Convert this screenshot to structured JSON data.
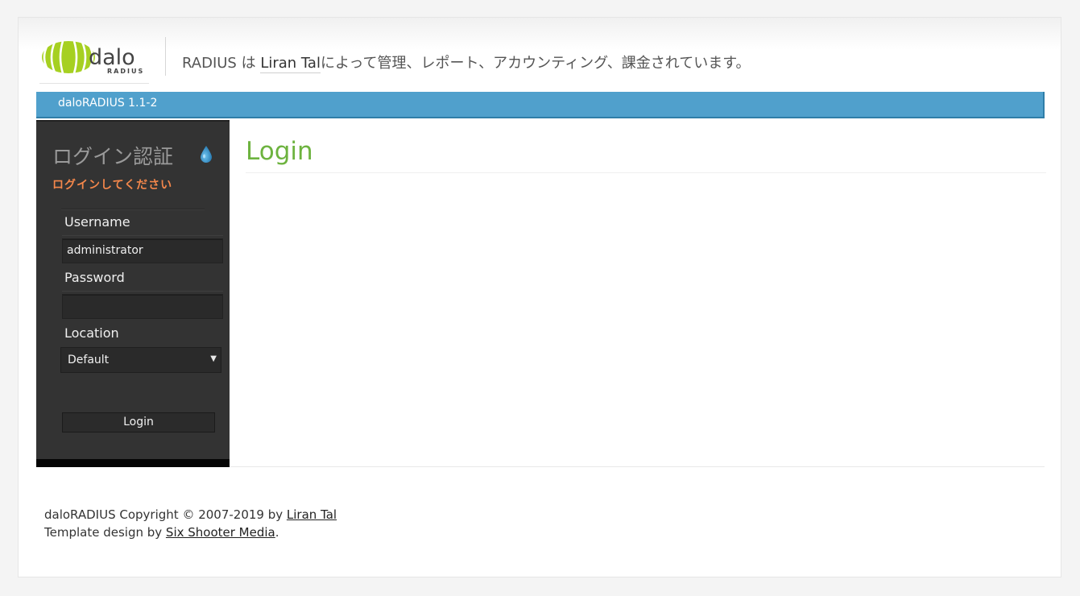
{
  "header": {
    "logo_text": "dalo",
    "logo_subtext": "RADIUS",
    "tagline_prefix": "RADIUS は ",
    "tagline_author": "Liran Tal",
    "tagline_suffix": "によって管理、レポート、アカウンティング、課金されています。"
  },
  "navbar": {
    "version": "daloRADIUS 1.1-2"
  },
  "sidebar": {
    "title": "ログイン認証",
    "subtitle": "ログインしてください",
    "username_label": "Username",
    "username_value": "administrator",
    "password_label": "Password",
    "password_value": "",
    "location_label": "Location",
    "location_value": "Default",
    "login_button": "Login"
  },
  "main": {
    "title": "Login"
  },
  "footer": {
    "copyright_prefix": "daloRADIUS Copyright © 2007-2019 by ",
    "copyright_author": "Liran Tal",
    "template_prefix": "Template design by ",
    "template_author": "Six Shooter Media",
    "template_suffix": "."
  },
  "colors": {
    "navbar": "#50a0cc",
    "title_green": "#6db33f",
    "subtitle_orange": "#f4874b",
    "sidebar_bg": "#333333",
    "logo_green": "#9ccc1c"
  },
  "icons": {
    "logo": "radius-logo-icon",
    "drop": "water-drop-icon",
    "caret": "chevron-down-icon"
  }
}
